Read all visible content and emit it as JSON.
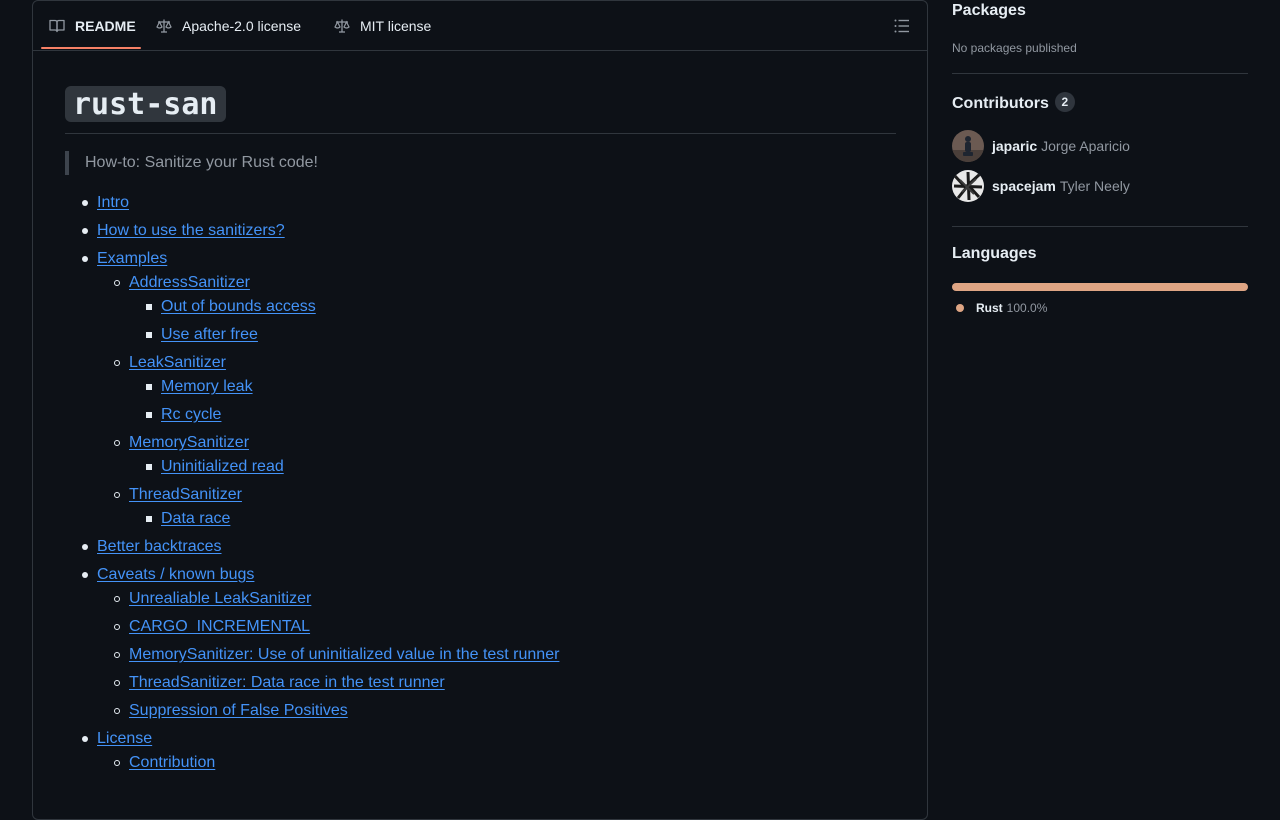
{
  "tabs": [
    {
      "label": "README",
      "icon": "book-icon",
      "active": true
    },
    {
      "label": "Apache-2.0 license",
      "icon": "law-icon"
    },
    {
      "label": "MIT license",
      "icon": "law-icon"
    }
  ],
  "readme": {
    "title": "rust-san",
    "quote": "How-to: Sanitize your Rust code!",
    "toc": [
      {
        "label": "Intro",
        "level": 1
      },
      {
        "label": "How to use the sanitizers?",
        "level": 1
      },
      {
        "label": "Examples",
        "level": 1
      },
      {
        "label": "AddressSanitizer",
        "level": 2
      },
      {
        "label": "Out of bounds access",
        "level": 3
      },
      {
        "label": "Use after free",
        "level": 3
      },
      {
        "label": "LeakSanitizer",
        "level": 2
      },
      {
        "label": "Memory leak",
        "level": 3
      },
      {
        "label": "Rc cycle",
        "level": 3
      },
      {
        "label": "MemorySanitizer",
        "level": 2
      },
      {
        "label": "Uninitialized read",
        "level": 3
      },
      {
        "label": "ThreadSanitizer",
        "level": 2
      },
      {
        "label": "Data race",
        "level": 3
      },
      {
        "label": "Better backtraces",
        "level": 1
      },
      {
        "label": "Caveats / known bugs",
        "level": 1
      },
      {
        "label": "Unrealiable LeakSanitizer",
        "level": 2
      },
      {
        "label": "CARGO_INCREMENTAL",
        "level": 2
      },
      {
        "label": "MemorySanitizer: Use of uninitialized value in the test runner",
        "level": 2
      },
      {
        "label": "ThreadSanitizer: Data race in the test runner",
        "level": 2
      },
      {
        "label": "Suppression of False Positives",
        "level": 2
      },
      {
        "label": "License",
        "level": 1
      },
      {
        "label": "Contribution",
        "level": 2
      }
    ]
  },
  "sidebar": {
    "packages": {
      "heading": "Packages",
      "text": "No packages published"
    },
    "contributors": {
      "heading": "Contributors",
      "count": "2",
      "people": [
        {
          "login": "japaric",
          "name": "Jorge Aparicio"
        },
        {
          "login": "spacejam",
          "name": "Tyler Neely"
        }
      ]
    },
    "languages": {
      "heading": "Languages",
      "items": [
        {
          "name": "Rust",
          "percent": "100.0%",
          "fraction": 1.0,
          "color": "#dea584"
        }
      ]
    }
  },
  "colors": {
    "link": "#4493f8",
    "tab_underline": "#f78166",
    "background": "#0d1117",
    "border": "#30363d"
  }
}
